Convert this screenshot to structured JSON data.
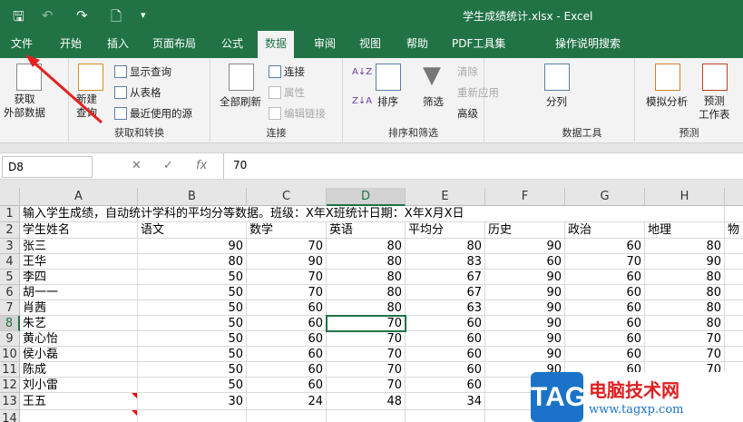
{
  "window": {
    "title": "学生成绩统计.xlsx  -  Excel"
  },
  "quick_access": {
    "save": "🖫",
    "undo": "↶",
    "redo": "↷",
    "preview": "🗋",
    "customize": "▾"
  },
  "tabs": [
    "文件",
    "开始",
    "插入",
    "页面布局",
    "公式",
    "数据",
    "审阅",
    "视图",
    "帮助",
    "PDF工具集",
    "操作说明搜索"
  ],
  "active_tab": "数据",
  "ribbon": {
    "get_external": "获取\n外部数据",
    "new_query": "新建\n查询",
    "show_query": "显示查询",
    "from_table": "从表格",
    "recent_sources": "最近使用的源",
    "group1": "获取和转换",
    "refresh_all": "全部刷新",
    "connections": "连接",
    "properties": "属性",
    "edit_links": "编辑链接",
    "group2": "连接",
    "sort": "排序",
    "filter": "筛选",
    "clear": "清除",
    "reapply": "重新应用",
    "advanced": "高级",
    "group3": "排序和筛选",
    "text_to_columns": "分列",
    "group4": "数据工具",
    "what_if": "模拟分析",
    "forecast_sheet": "预测\n工作表",
    "group5": "预测"
  },
  "formula_bar": {
    "name_box": "D8",
    "cancel": "✕",
    "enter": "✓",
    "fx": "fx",
    "value": "70"
  },
  "sheet": {
    "columns": [
      "A",
      "B",
      "C",
      "D",
      "E",
      "F",
      "G",
      "H",
      ""
    ],
    "selected_column": "D",
    "selected_row": 8,
    "row1": "输入学生成绩，自动统计学科的平均分等数据。班级：X年X班统计日期：X年X月X日",
    "headers": [
      "学生姓名",
      "语文",
      "数学",
      "英语",
      "平均分",
      "历史",
      "政治",
      "地理",
      "物"
    ],
    "rows": [
      [
        "张三",
        "90",
        "70",
        "80",
        "80",
        "90",
        "60",
        "80"
      ],
      [
        "王华",
        "80",
        "90",
        "80",
        "83",
        "60",
        "70",
        "90"
      ],
      [
        "李四",
        "50",
        "70",
        "80",
        "67",
        "90",
        "60",
        "80"
      ],
      [
        "胡一一",
        "50",
        "70",
        "80",
        "67",
        "90",
        "60",
        "80"
      ],
      [
        "肖茜",
        "50",
        "60",
        "80",
        "63",
        "90",
        "60",
        "80"
      ],
      [
        "朱艺",
        "50",
        "60",
        "70",
        "60",
        "90",
        "60",
        "80"
      ],
      [
        "黄心怡",
        "50",
        "60",
        "70",
        "60",
        "90",
        "60",
        "70"
      ],
      [
        "侯小磊",
        "50",
        "60",
        "70",
        "60",
        "90",
        "60",
        "70"
      ],
      [
        "陈成",
        "50",
        "60",
        "70",
        "60",
        "90",
        "60",
        "70"
      ],
      [
        "刘小雷",
        "50",
        "60",
        "70",
        "60",
        "",
        "",
        ""
      ],
      [
        "王五",
        "30",
        "24",
        "48",
        "34",
        "",
        "",
        ""
      ]
    ]
  },
  "watermark": {
    "logo": "TAG",
    "site_name": "电脑技术网",
    "url": "www.tagxp.com"
  }
}
